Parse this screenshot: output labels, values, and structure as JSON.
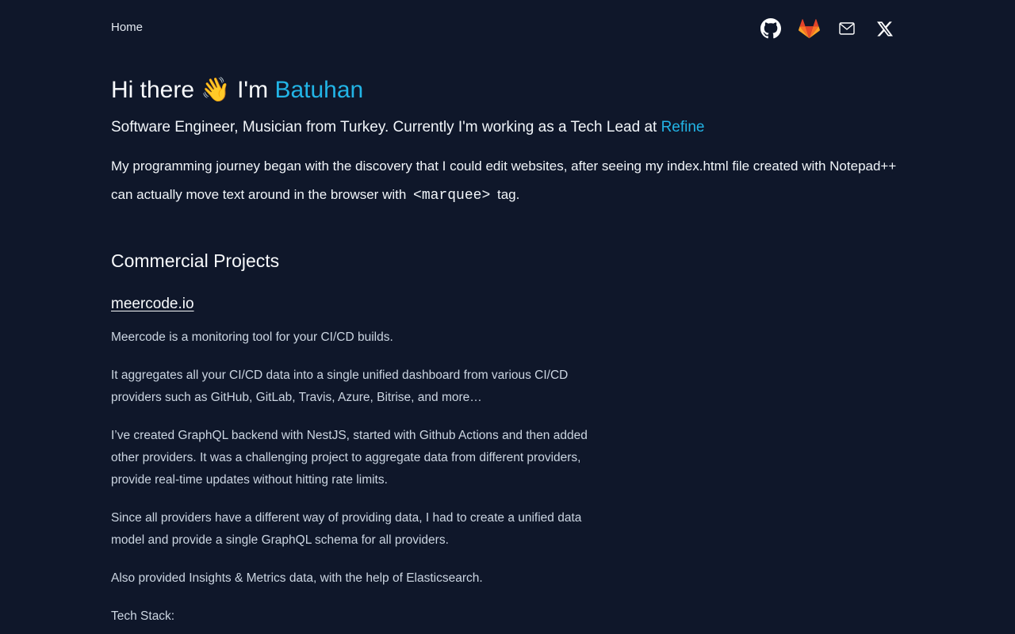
{
  "nav": {
    "home_label": "Home",
    "icons": [
      {
        "name": "github-icon",
        "color": "#ffffff"
      },
      {
        "name": "gitlab-icon",
        "color": "#fc6d26"
      },
      {
        "name": "mail-icon",
        "color": "#ffffff"
      },
      {
        "name": "x-twitter-icon",
        "color": "#ffffff"
      }
    ]
  },
  "hero": {
    "greeting": "Hi there 👋 I'm ",
    "name": "Batuhan",
    "subtitle_prefix": "Software Engineer, Musician from Turkey. Currently I'm working as a Tech Lead at ",
    "company": "Refine",
    "intro_part1": "My programming journey began with the discovery that I could edit websites, after seeing my index.html file created with Notepad++ can actually move text around in the browser with ",
    "intro_code": "<marquee>",
    "intro_part2": " tag."
  },
  "projects": {
    "heading": "Commercial Projects",
    "items": [
      {
        "title": "meercode.io",
        "paragraphs": [
          "Meercode is a monitoring tool for your CI/CD builds.",
          "It aggregates all your CI/CD data into a single unified dashboard from various CI/CD providers such as GitHub, GitLab, Travis, Azure, Bitrise, and more…",
          "I’ve created GraphQL backend with NestJS, started with Github Actions and then added other providers. It was a challenging project to aggregate data from different providers, provide real-time updates without hitting rate limits.",
          "Since all providers have a different way of providing data, I had to create a unified data model and provide a single GraphQL schema for all providers.",
          "Also provided Insights & Metrics data, with the help of Elasticsearch.",
          "Tech Stack:"
        ]
      }
    ]
  },
  "colors": {
    "background": "#0f172a",
    "accent": "#22b4e6",
    "text": "#f1f5f9",
    "muted_text": "#cbd5e1"
  }
}
